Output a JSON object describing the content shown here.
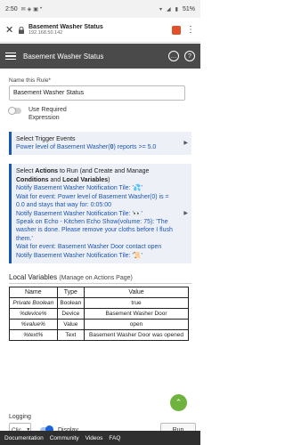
{
  "status_bar": {
    "time": "2:50",
    "icons": [
      "mail-icon",
      "hubitat-icon",
      "photo-icon",
      "dot-icon"
    ],
    "battery": "51%"
  },
  "browser": {
    "title": "Basement Washer Status",
    "url": "192.168.50.142"
  },
  "header": {
    "title": "Basement Washer Status"
  },
  "rule_name": {
    "label": "Name this Rule*",
    "value": "Basement Washer Status"
  },
  "required_expression": {
    "label": "Use Required Expression"
  },
  "trigger": {
    "title": "Select Trigger Events",
    "text_pre": "Power level of Basement Washer(",
    "text_bold": "0",
    "text_post": ") reports >= 5.0"
  },
  "actions": {
    "title_pre": "Select ",
    "title_bold1": "Actions",
    "title_mid": " to Run (and Create and Manage ",
    "title_bold2": "Conditions",
    "title_and": " and ",
    "title_bold3": "Local Variables",
    "title_end": ")",
    "lines": [
      "Notify Basement Washer Notification Tile: '💦'",
      "Wait for event: Power level of Basement Washer(0) is = 0.0 and stays that way for: 0:05:00",
      "Notify Basement Washer Notification Tile: '👀'",
      "Speak on Echo - Kitchen Echo Show(volume: 75): 'The washer is done. Please remove your cloths before I flush them.'",
      "Wait for event: Basement Washer Door contact open",
      "Notify Basement Washer Notification Tile: '📜'"
    ]
  },
  "local_variables": {
    "title": "Local Variables",
    "subtitle": "(Manage on Actions Page)",
    "columns": [
      "Name",
      "Type",
      "Value"
    ],
    "rows": [
      {
        "name": "Private Boolean",
        "type": "Boolean",
        "value": "true"
      },
      {
        "name": "%device%",
        "type": "Device",
        "value": "Basement Washer Door"
      },
      {
        "name": "%value%",
        "type": "Value",
        "value": "open"
      },
      {
        "name": "%text%",
        "type": "Text",
        "value": "Basement Washer Door was opened"
      }
    ]
  },
  "logging": {
    "label": "Logging",
    "select_value": "Clic...",
    "display_label": "Display",
    "run_label": "Run"
  },
  "footer": {
    "items": [
      "Documentation",
      "Community",
      "Videos",
      "FAQ"
    ]
  },
  "colors": {
    "header_bg": "#4a4a4a",
    "link": "#1a56b4",
    "accent_green": "#6fb33f",
    "footer_bg": "#2f2f2f"
  }
}
